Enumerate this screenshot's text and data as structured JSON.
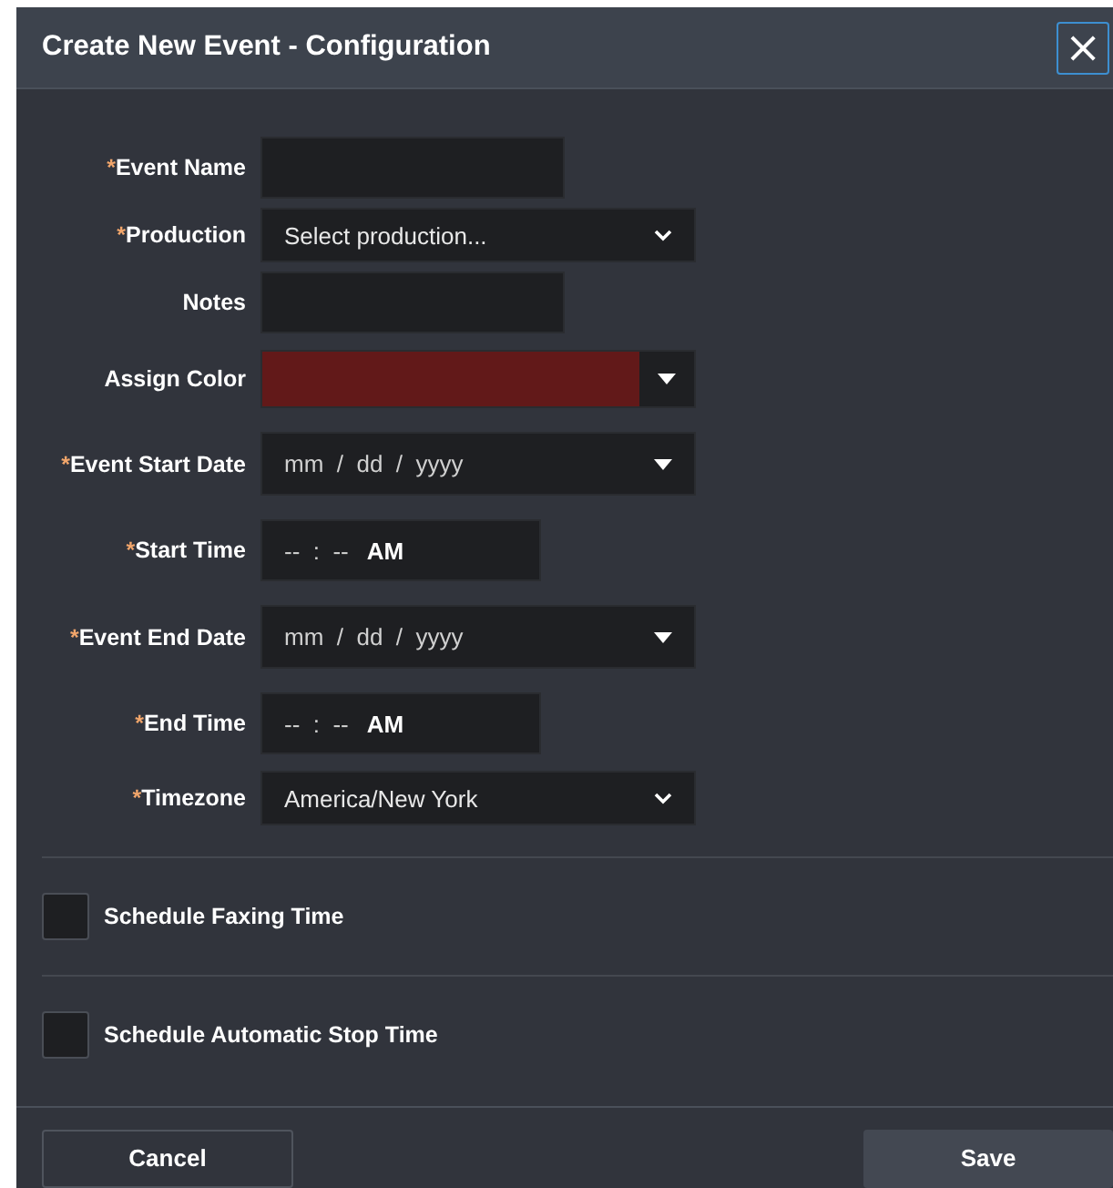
{
  "dialog": {
    "title": "Create New Event - Configuration",
    "close": "×"
  },
  "required_mark": "*",
  "fields": [
    {
      "label": "Event Name",
      "required": true,
      "kind": "text"
    },
    {
      "label": "Production",
      "required": true,
      "kind": "select",
      "value": "Select production..."
    },
    {
      "label": "Notes",
      "required": false,
      "kind": "text"
    },
    {
      "label": "Assign Color",
      "required": false,
      "kind": "color",
      "color": "#621919"
    },
    {
      "label": "Event Start Date",
      "required": true,
      "kind": "date",
      "placeholder": "mm  /  dd  /  yyyy"
    },
    {
      "label": "Start Time",
      "required": true,
      "kind": "time",
      "placeholder": "--  :  --",
      "meridiem": "AM"
    },
    {
      "label": "Event End Date",
      "required": true,
      "kind": "date",
      "placeholder": "mm  /  dd  /  yyyy"
    },
    {
      "label": "End Time",
      "required": true,
      "kind": "time",
      "placeholder": "--  :  --",
      "meridiem": "AM"
    },
    {
      "label": "Timezone",
      "required": true,
      "kind": "select",
      "value": "America/New York"
    }
  ],
  "options": [
    {
      "label": "Schedule Faxing Time",
      "checked": false
    },
    {
      "label": "Schedule Automatic Stop Time",
      "checked": false
    }
  ],
  "buttons": {
    "cancel": "Cancel",
    "save": "Save"
  }
}
